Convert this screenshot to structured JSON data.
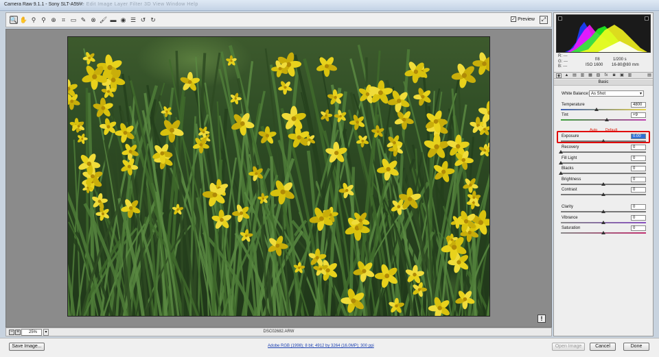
{
  "window": {
    "title": "Camera Raw 9.1.1  -  Sony SLT-A55V",
    "ghost_menu": "File   Edit   Image   Layer   Filter   3D   View   Window   Help"
  },
  "toolbar": {
    "tools": [
      {
        "icon": "zoom-icon",
        "glyph": "🔍",
        "active": true
      },
      {
        "icon": "hand-icon",
        "glyph": "✋",
        "active": false
      },
      {
        "icon": "white-balance-icon",
        "glyph": "⚲",
        "active": false
      },
      {
        "icon": "color-sampler-icon",
        "glyph": "⚲",
        "active": false
      },
      {
        "icon": "targeted-adjustment-icon",
        "glyph": "⊕",
        "active": false
      },
      {
        "icon": "crop-icon",
        "glyph": "⌗",
        "active": false
      },
      {
        "icon": "straighten-icon",
        "glyph": "▭",
        "active": false
      },
      {
        "icon": "spot-removal-icon",
        "glyph": "✎",
        "active": false
      },
      {
        "icon": "red-eye-icon",
        "glyph": "⊗",
        "active": false
      },
      {
        "icon": "adjustment-brush-icon",
        "glyph": "🖌",
        "active": false
      },
      {
        "icon": "graduated-filter-icon",
        "glyph": "▬",
        "active": false
      },
      {
        "icon": "radial-filter-icon",
        "glyph": "◉",
        "active": false
      },
      {
        "icon": "preferences-icon",
        "glyph": "☰",
        "active": false
      },
      {
        "icon": "rotate-ccw-icon",
        "glyph": "↺",
        "active": false
      },
      {
        "icon": "rotate-cw-icon",
        "glyph": "↻",
        "active": false
      }
    ],
    "preview_label": "Preview",
    "preview_checked": "✓",
    "fullscreen_glyph": "⤢"
  },
  "status": {
    "zoom": "25%",
    "zoom_minus": "−",
    "zoom_plus": "+",
    "zoom_drop": "▾",
    "filename": "DSC02682.ARW",
    "warning_glyph": "!"
  },
  "bottom": {
    "save_label": "Save Image...",
    "workflow": "Adobe RGB (1998); 8 bit; 4912 by 3264 (16.0MP); 300 ppi",
    "open_label": "Open Image",
    "cancel_label": "Cancel",
    "done_label": "Done"
  },
  "info": {
    "r": "R:   ---",
    "g": "G:   ---",
    "b": "B:   ---",
    "aperture": "f/8",
    "shutter": "1/200 s",
    "iso": "ISO 1600",
    "lens": "16-80@80 mm"
  },
  "panel": {
    "tabs": [
      "◉",
      "▲",
      "▤",
      "▥",
      "▦",
      "▧",
      "fx",
      "◙",
      "▣",
      "▥",
      "▤"
    ],
    "header": "Basic",
    "wb_label": "White Balance:",
    "wb_value": "As Shot",
    "auto_label": "Auto",
    "default_label": "Default",
    "sliders": [
      {
        "label": "Temperature",
        "value": "4800",
        "pos": 0.42
      },
      {
        "label": "Tint",
        "value": "+9",
        "pos": 0.54
      },
      {
        "label": "Exposure",
        "value": "0.00",
        "pos": 0.5
      },
      {
        "label": "Recovery",
        "value": "0",
        "pos": 0.0
      },
      {
        "label": "Fill Light",
        "value": "0",
        "pos": 0.0
      },
      {
        "label": "Blacks",
        "value": "0",
        "pos": 0.0
      },
      {
        "label": "Brightness",
        "value": "0",
        "pos": 0.5
      },
      {
        "label": "Contrast",
        "value": "0",
        "pos": 0.5
      },
      {
        "label": "Clarity",
        "value": "0",
        "pos": 0.5
      },
      {
        "label": "Vibrance",
        "value": "0",
        "pos": 0.5
      },
      {
        "label": "Saturation",
        "value": "0",
        "pos": 0.5
      }
    ]
  },
  "colors": {
    "highlight": "#e00000",
    "link": "#1a3fb0"
  }
}
